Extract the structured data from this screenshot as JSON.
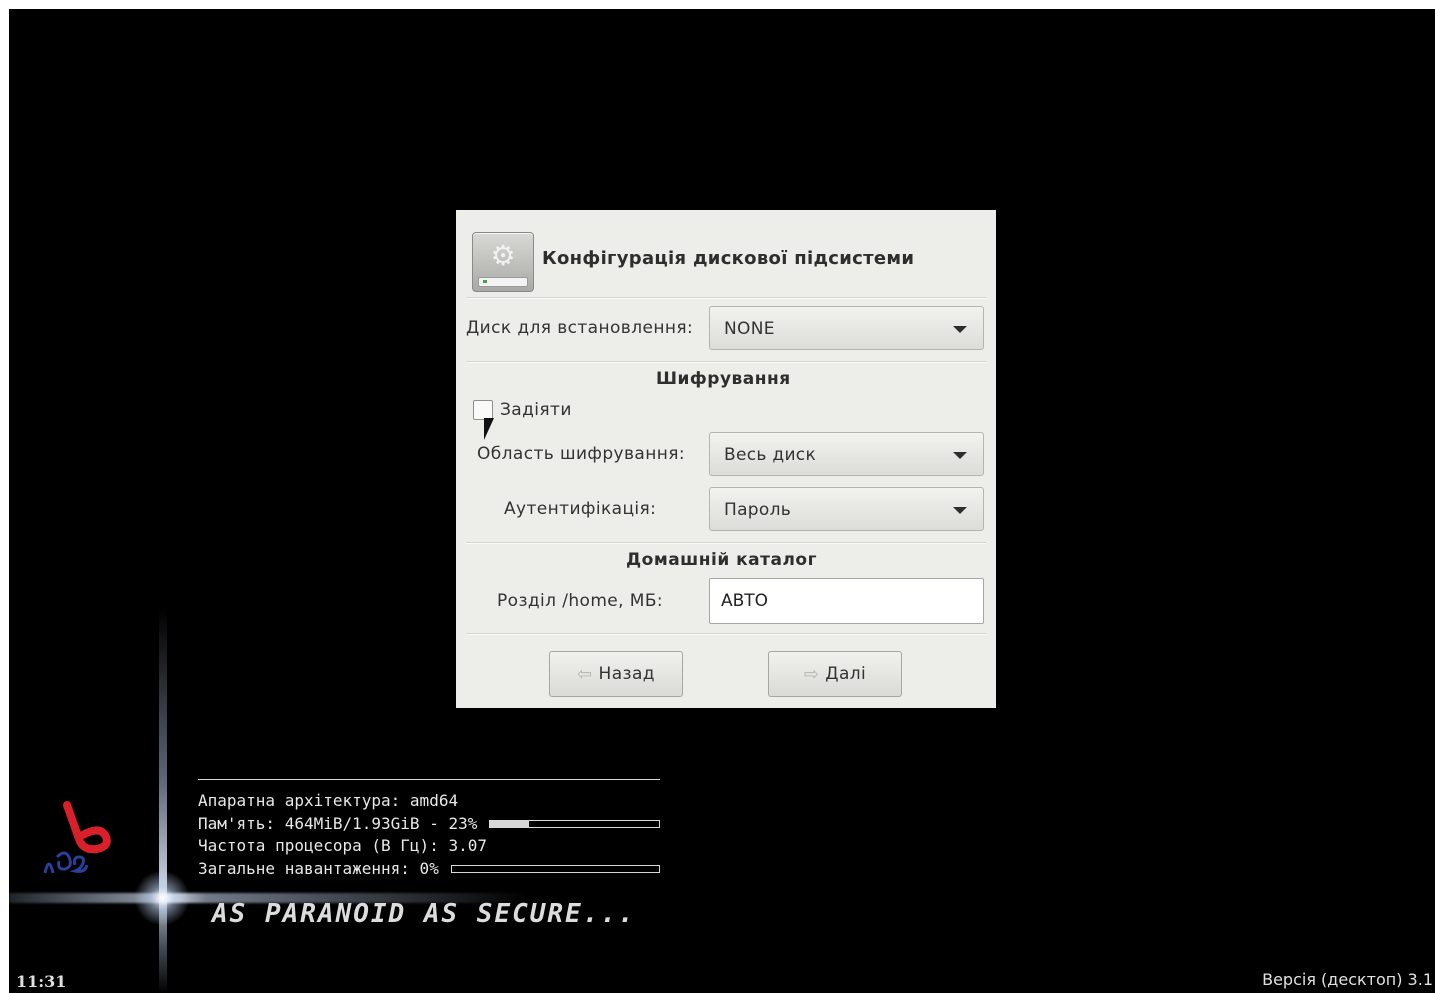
{
  "dialog": {
    "title": "Конфігурація дискової підсистеми",
    "disk_label": "Диск для встановлення:",
    "disk_value": "NONE",
    "encryption_section": "Шифрування",
    "enable_label": "Задіяти",
    "enable_checked": false,
    "area_label": "Область шифрування:",
    "area_value": "Весь диск",
    "auth_label": "Аутентифікація:",
    "auth_value": "Пароль",
    "home_section": "Домашній каталог",
    "home_label": "Розділ /home, МБ:",
    "home_value": "АВТО",
    "back_label": "Назад",
    "next_label": "Далі"
  },
  "sysinfo": {
    "arch": "Апаратна архітектура: amd64",
    "memory": "Пам'ять: 464MiB/1.93GiB - 23%",
    "memory_percent": 23,
    "cpu": "Частота процесора (В Гц): 3.07",
    "load": "Загальне навантаження: 0%",
    "load_percent": 0
  },
  "slogan": "AS PARANOID AS SECURE...",
  "clock": "11:31",
  "version": "Версія (десктоп) 3.1",
  "icons": {
    "header": "disk-settings-icon",
    "back": "arrow-left-icon",
    "next": "arrow-right-icon",
    "logo": "bos-logo"
  },
  "colors": {
    "background": "#000000",
    "dialog": "#ededea",
    "logo_red": "#d8202a",
    "logo_blue": "#2a3f9a"
  }
}
